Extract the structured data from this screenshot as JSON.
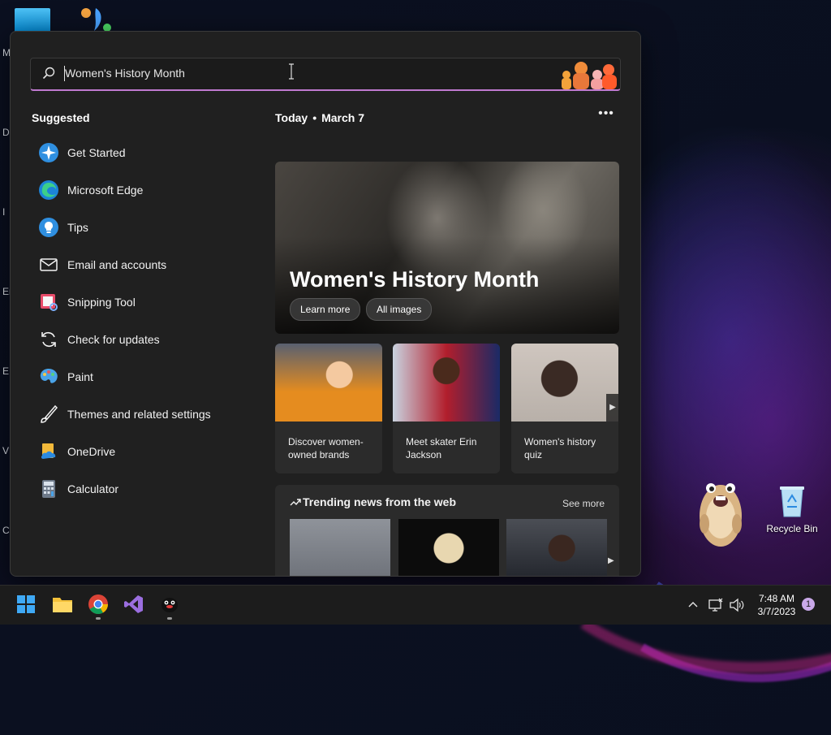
{
  "search": {
    "value": "Women's History Month"
  },
  "suggested": {
    "title": "Suggested",
    "items": [
      {
        "label": "Get Started",
        "icon": "get-started-icon"
      },
      {
        "label": "Microsoft Edge",
        "icon": "edge-icon"
      },
      {
        "label": "Tips",
        "icon": "tips-icon"
      },
      {
        "label": "Email and accounts",
        "icon": "mail-icon"
      },
      {
        "label": "Snipping Tool",
        "icon": "snipping-tool-icon"
      },
      {
        "label": "Check for updates",
        "icon": "refresh-icon"
      },
      {
        "label": "Paint",
        "icon": "paint-icon"
      },
      {
        "label": "Themes and related settings",
        "icon": "brush-icon"
      },
      {
        "label": "OneDrive",
        "icon": "onedrive-icon"
      },
      {
        "label": "Calculator",
        "icon": "calculator-icon"
      }
    ]
  },
  "today": {
    "label": "Today",
    "date": "March 7",
    "more": "•••"
  },
  "hero": {
    "title": "Women's History Month",
    "learn_more": "Learn more",
    "all_images": "All images"
  },
  "cards": [
    {
      "caption": "Discover women-owned brands"
    },
    {
      "caption": "Meet skater Erin Jackson"
    },
    {
      "caption": "Women's history quiz"
    }
  ],
  "trending": {
    "title": "Trending news from the web",
    "see_more": "See more"
  },
  "desktop": {
    "recycle_bin": "Recycle Bin",
    "left_edge_letters": [
      "M",
      "Da",
      "I",
      "En",
      "E",
      "V",
      "C"
    ]
  },
  "taskbar": {
    "time": "7:48 AM",
    "date": "3/7/2023",
    "notifications": "1",
    "apps": [
      "windows-start-icon",
      "file-explorer-icon",
      "chrome-icon",
      "visual-studio-icon",
      "penguin-app-icon"
    ]
  },
  "colors": {
    "accent": "#c07ad0",
    "panel": "#202020",
    "card": "#2b2b2b",
    "taskbar": "#1c1c1c"
  }
}
